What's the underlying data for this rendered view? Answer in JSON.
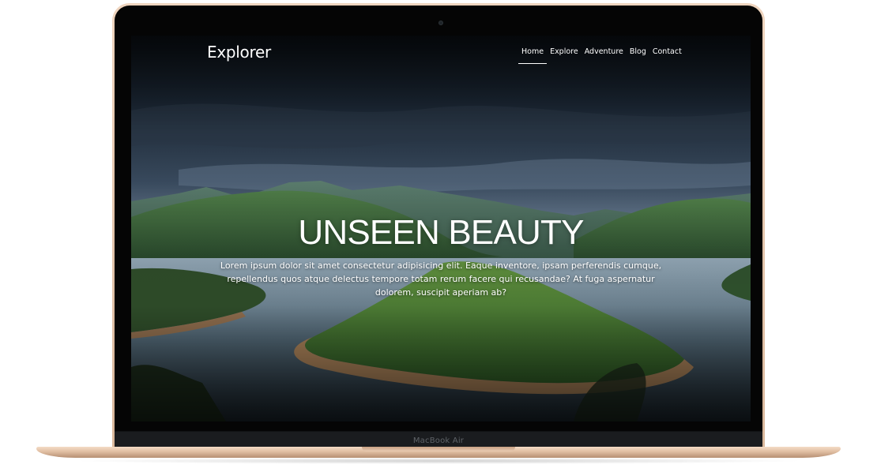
{
  "device": {
    "label": "MacBook Air"
  },
  "site": {
    "brand": "Explorer",
    "nav": [
      {
        "label": "Home",
        "active": true
      },
      {
        "label": "Explore",
        "active": false
      },
      {
        "label": "Adventure",
        "active": false
      },
      {
        "label": "Blog",
        "active": false
      },
      {
        "label": "Contact",
        "active": false
      }
    ]
  },
  "hero": {
    "title": "UNSEEN BEAUTY",
    "text": "Lorem ipsum dolor sit amet consectetur adipisicing elit. Eaque inventore, ipsam perferendis cumque, repellendus quos atque delectus tempore totam rerum facere qui recusandae? At fuga aspernatur dolorem, suscipit aperiam ab?"
  },
  "colors": {
    "frame_gold": "#e6c6ab",
    "bezel": "#050505",
    "text": "#ffffff"
  }
}
